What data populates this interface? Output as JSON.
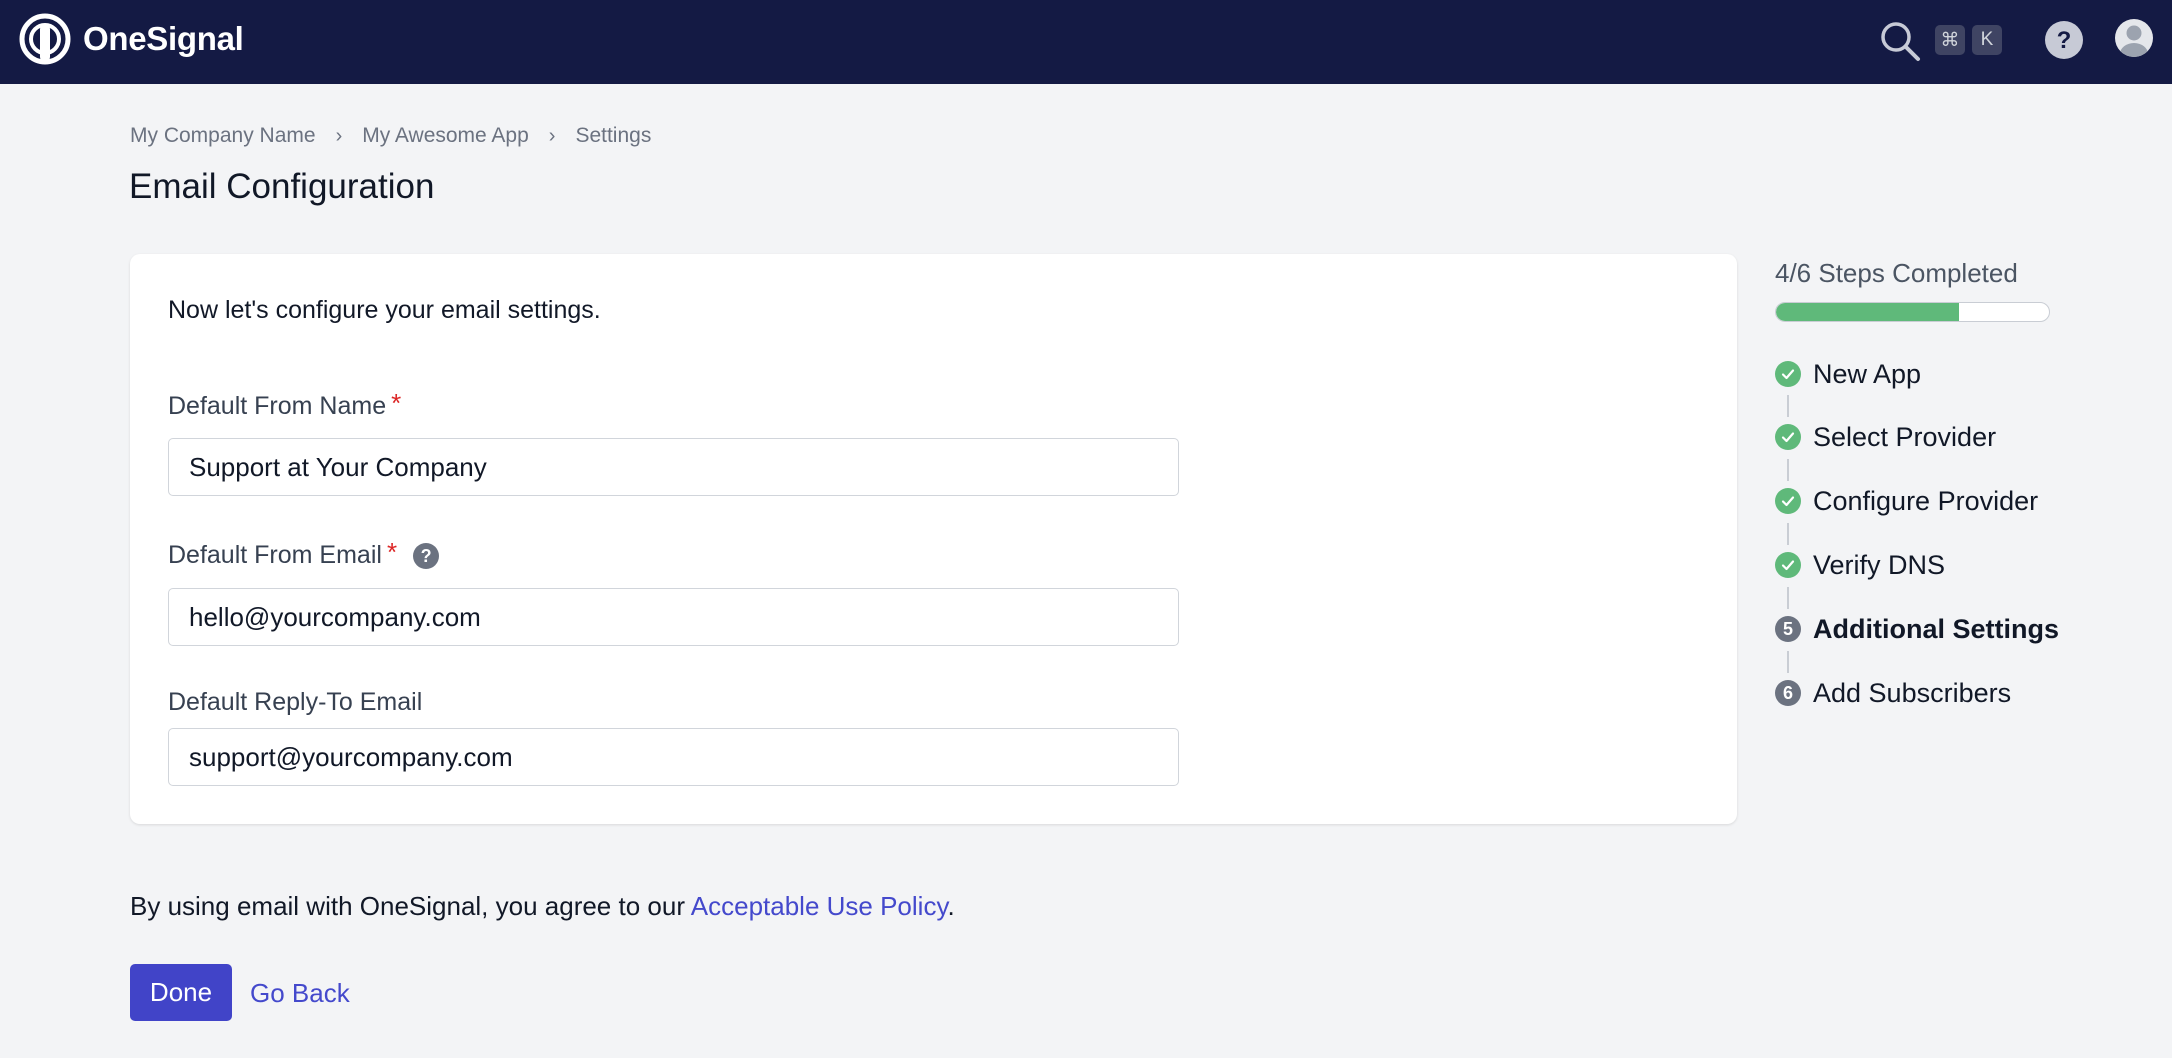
{
  "header": {
    "brand": "OneSignal",
    "shortcut_cmd": "⌘",
    "shortcut_key": "K",
    "icons": [
      "onesignal-logo",
      "search-icon",
      "help-icon",
      "user-avatar-icon"
    ]
  },
  "breadcrumb": [
    "My Company Name",
    "My Awesome App",
    "Settings"
  ],
  "breadcrumb_separator": "›",
  "page_title": "Email Configuration",
  "form": {
    "intro": "Now let's configure your email settings.",
    "from_name": {
      "label": "Default From Name",
      "value": "Support at Your Company",
      "required": true
    },
    "from_email": {
      "label": "Default From Email",
      "value": "hello@yourcompany.com",
      "required": true,
      "help": "?"
    },
    "reply_to": {
      "label": "Default Reply-To Email",
      "value": "support@yourcompany.com",
      "required": false
    },
    "required_marker": "*"
  },
  "agreement": {
    "prefix": "By using email with OneSignal, you agree to our ",
    "link": "Acceptable Use Policy",
    "suffix": "."
  },
  "actions": {
    "done": "Done",
    "back": "Go Back"
  },
  "progress": {
    "title": "4/6 Steps Completed",
    "completed": 4,
    "total": 6,
    "bar_fill_percent": 67,
    "steps": [
      {
        "label": "New App",
        "status": "done"
      },
      {
        "label": "Select Provider",
        "status": "done"
      },
      {
        "label": "Configure Provider",
        "status": "done"
      },
      {
        "label": "Verify DNS",
        "status": "done"
      },
      {
        "label": "Additional Settings",
        "status": "current",
        "number": "5"
      },
      {
        "label": "Add Subscribers",
        "status": "upcoming",
        "number": "6"
      }
    ]
  },
  "colors": {
    "topbar": "#141a44",
    "primary": "#4144c8",
    "link": "#4449cc",
    "success": "#5fb97a",
    "required": "#dc2626"
  }
}
